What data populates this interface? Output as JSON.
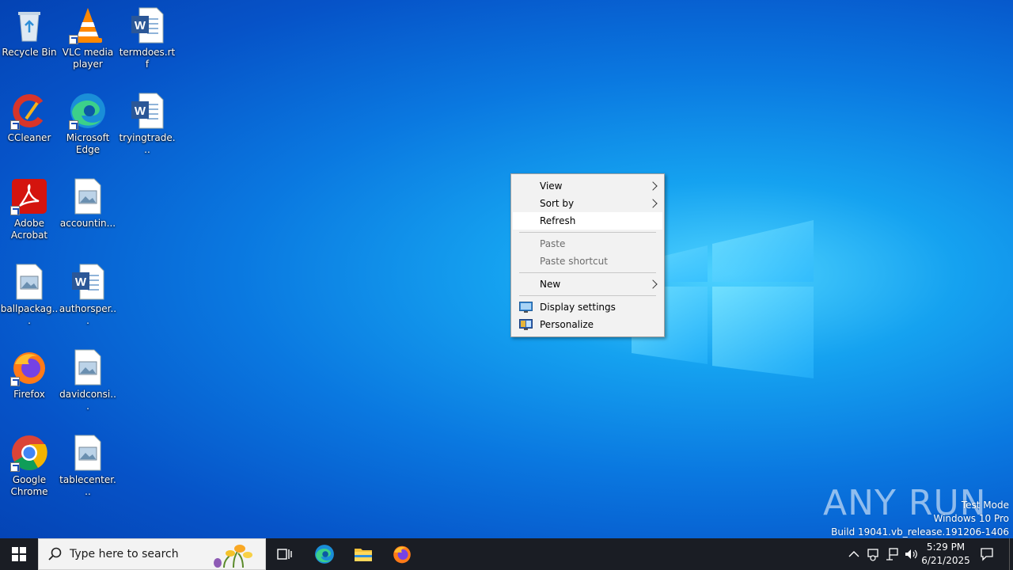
{
  "desktop": {
    "icons": [
      {
        "label": "Recycle Bin",
        "icon": "recycle-bin-icon"
      },
      {
        "label": "VLC media player",
        "icon": "vlc-icon"
      },
      {
        "label": "termdoes.rtf",
        "icon": "word-doc-icon"
      },
      {
        "label": "CCleaner",
        "icon": "ccleaner-icon"
      },
      {
        "label": "Microsoft Edge",
        "icon": "edge-icon"
      },
      {
        "label": "tryingtrade...",
        "icon": "word-doc-icon"
      },
      {
        "label": "Adobe Acrobat",
        "icon": "acrobat-icon"
      },
      {
        "label": "accountin...",
        "icon": "image-file-icon"
      },
      {
        "label": "ballpackag...",
        "icon": "image-file-icon"
      },
      {
        "label": "authorsper...",
        "icon": "word-doc-icon"
      },
      {
        "label": "Firefox",
        "icon": "firefox-icon"
      },
      {
        "label": "davidconsi...",
        "icon": "image-file-icon"
      },
      {
        "label": "Google Chrome",
        "icon": "chrome-icon"
      },
      {
        "label": "tablecenter...",
        "icon": "image-file-icon"
      }
    ]
  },
  "context_menu": {
    "items": [
      {
        "label": "View",
        "submenu": true,
        "disabled": false
      },
      {
        "label": "Sort by",
        "submenu": true,
        "disabled": false
      },
      {
        "label": "Refresh",
        "submenu": false,
        "disabled": false,
        "highlighted": true
      },
      {
        "label": "Paste",
        "submenu": false,
        "disabled": true
      },
      {
        "label": "Paste shortcut",
        "submenu": false,
        "disabled": true
      },
      {
        "label": "New",
        "submenu": true,
        "disabled": false
      },
      {
        "label": "Display settings",
        "submenu": false,
        "disabled": false,
        "icon": "display-settings-icon"
      },
      {
        "label": "Personalize",
        "submenu": false,
        "disabled": false,
        "icon": "personalize-icon"
      }
    ]
  },
  "watermark": {
    "brand": "ANY RUN",
    "line1": "Test Mode",
    "line2": "Windows 10 Pro",
    "line3": "Build 19041.vb_release.191206-1406"
  },
  "taskbar": {
    "search_placeholder": "Type here to search",
    "pinned": [
      "task-view-icon",
      "edge-icon",
      "file-explorer-icon",
      "firefox-icon"
    ],
    "clock_time": "5:29 PM",
    "clock_date": "6/21/2025"
  },
  "colors": {
    "taskbar_bg": "#1a1d24",
    "menu_bg": "#f2f2f2",
    "desktop_accent": "#0a78e0"
  }
}
